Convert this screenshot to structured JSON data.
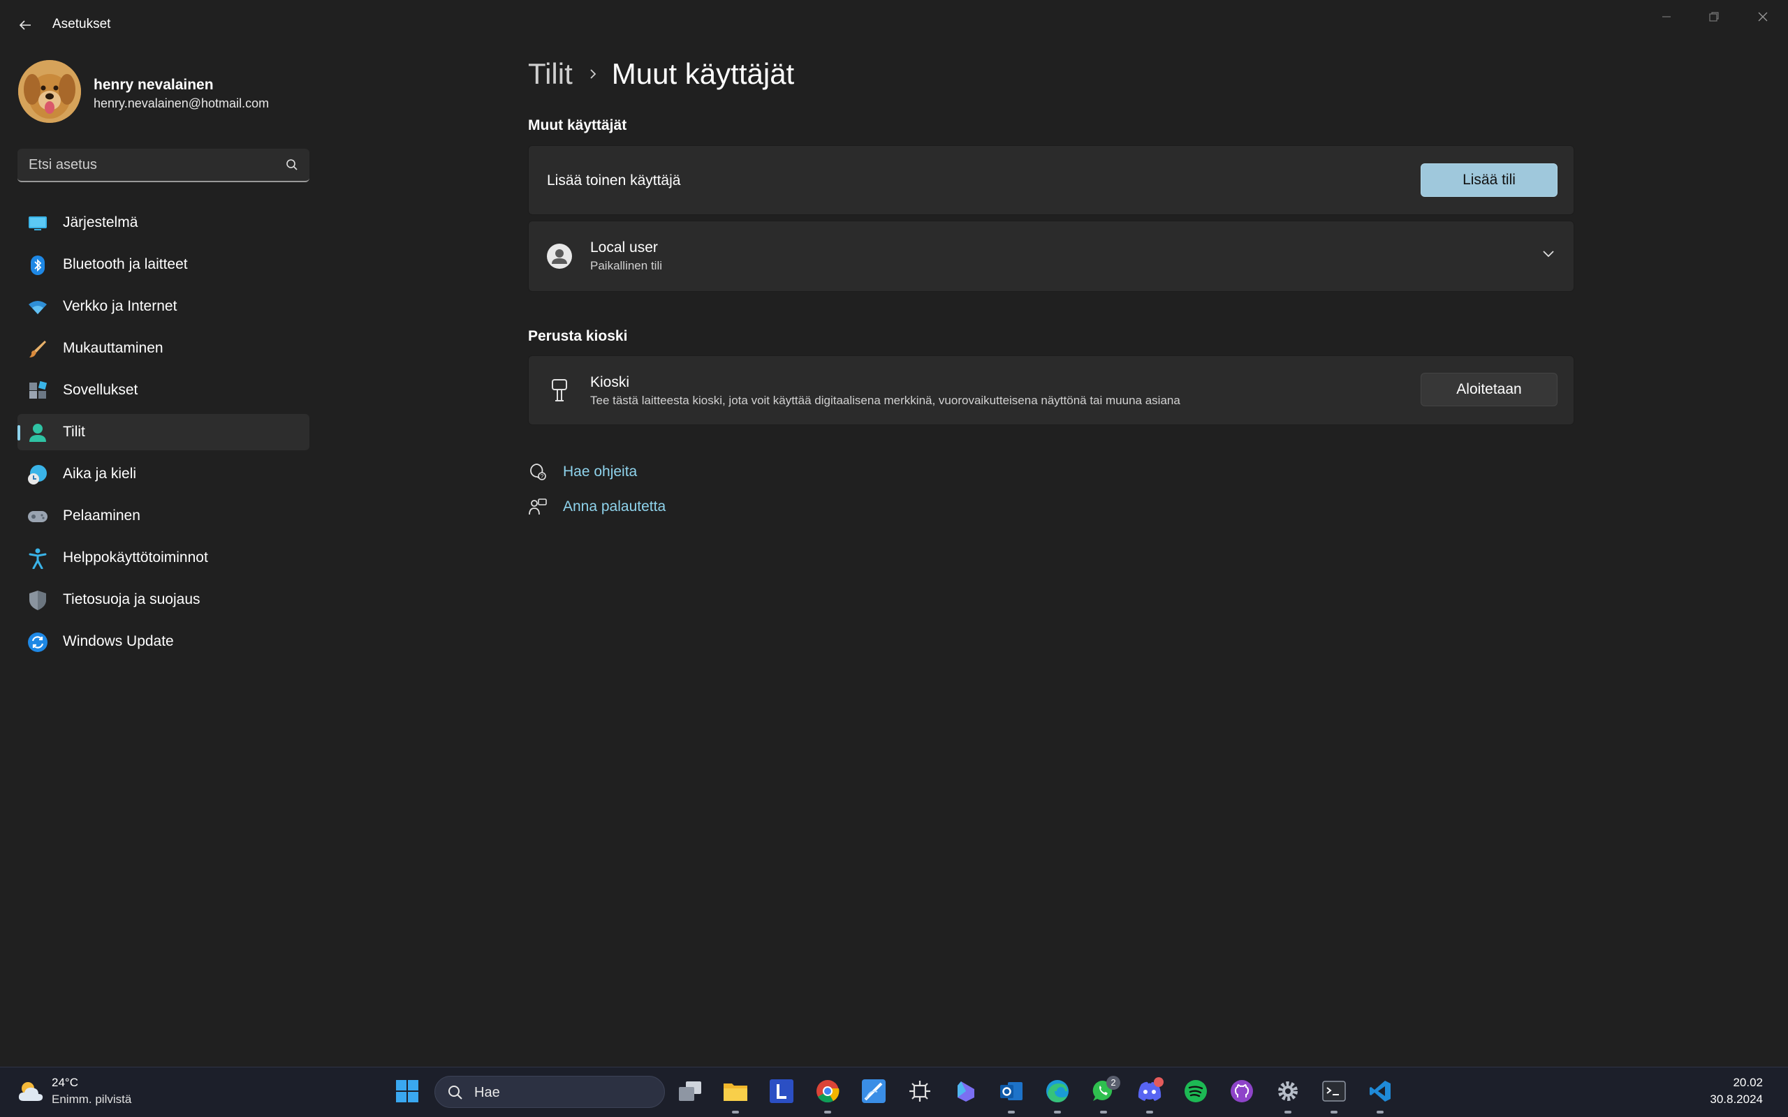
{
  "window": {
    "title": "Asetukset"
  },
  "profile": {
    "name": "henry nevalainen",
    "email": "henry.nevalainen@hotmail.com"
  },
  "search": {
    "placeholder": "Etsi asetus"
  },
  "sidebar": {
    "items": [
      {
        "label": "Järjestelmä",
        "icon": "monitor-icon"
      },
      {
        "label": "Bluetooth ja laitteet",
        "icon": "bluetooth-icon"
      },
      {
        "label": "Verkko ja Internet",
        "icon": "wifi-icon"
      },
      {
        "label": "Mukauttaminen",
        "icon": "brush-icon"
      },
      {
        "label": "Sovellukset",
        "icon": "apps-icon"
      },
      {
        "label": "Tilit",
        "icon": "account-icon",
        "active": true
      },
      {
        "label": "Aika ja kieli",
        "icon": "globe-clock-icon"
      },
      {
        "label": "Pelaaminen",
        "icon": "gamepad-icon"
      },
      {
        "label": "Helppokäyttötoiminnot",
        "icon": "accessibility-icon"
      },
      {
        "label": "Tietosuoja ja suojaus",
        "icon": "shield-icon"
      },
      {
        "label": "Windows Update",
        "icon": "update-icon"
      }
    ]
  },
  "breadcrumb": {
    "parent": "Tilit",
    "current": "Muut käyttäjät"
  },
  "sections": {
    "other_users": {
      "title": "Muut käyttäjät",
      "add_user_text": "Lisää toinen käyttäjä",
      "add_button": "Lisää tili",
      "local_user": {
        "name": "Local user",
        "type": "Paikallinen tili"
      }
    },
    "kiosk": {
      "title": "Perusta kioski",
      "name": "Kioski",
      "description": "Tee tästä laitteesta kioski, jota voit käyttää digitaalisena merkkinä, vuorovaikutteisena näyttönä tai muuna asiana",
      "button": "Aloitetaan"
    }
  },
  "links": {
    "help": "Hae ohjeita",
    "feedback": "Anna palautetta"
  },
  "taskbar": {
    "weather_temp": "24°C",
    "weather_desc": "Enimm. pilvistä",
    "search_label": "Hae",
    "whatsapp_badge": "2",
    "time": "20.02",
    "date": "30.8.2024"
  },
  "colors": {
    "accent": "#8fd3ec",
    "button_accent": "#9fc8dc",
    "background": "#202020",
    "card": "#2b2b2b"
  }
}
